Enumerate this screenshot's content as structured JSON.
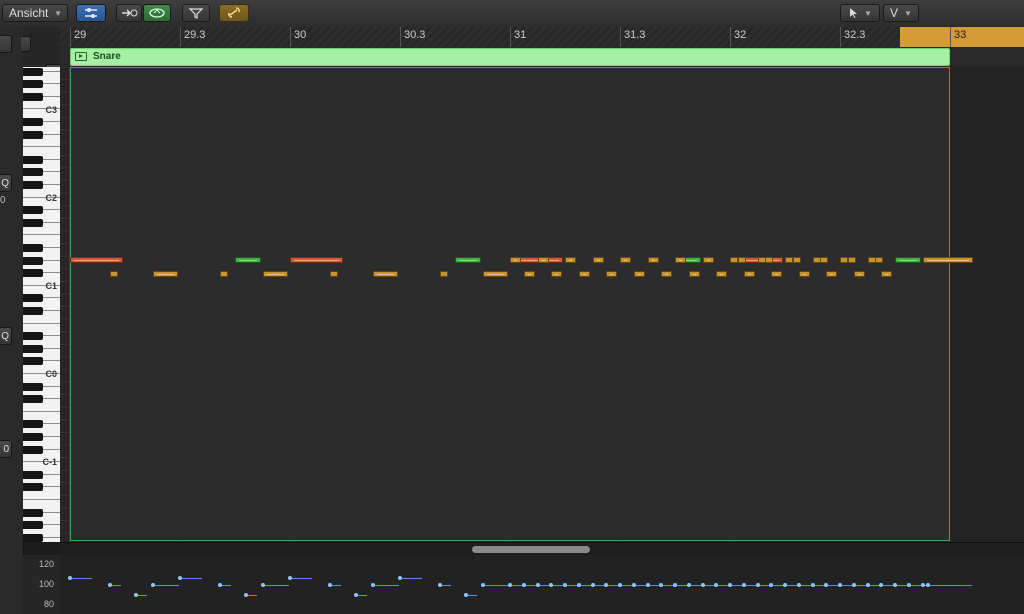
{
  "toolbar": {
    "view_menu_label": "Ansicht",
    "tool_pointer_label": "",
    "tool_secondary_label": "V",
    "colors": {
      "midi_in": "#2e63a8",
      "show_fx": "#3a8a45",
      "link": "#c79a3a"
    }
  },
  "ruler": {
    "bars": [
      "29",
      "29.3",
      "30",
      "30.3",
      "31",
      "31.3",
      "32",
      "32.3",
      "33"
    ],
    "cycle_color": "#d59b37"
  },
  "region": {
    "name": "Snare",
    "color": "#a6f0a6"
  },
  "piano": {
    "labels": [
      "C3",
      "C2",
      "C1",
      "C0",
      "C-1"
    ]
  },
  "left_panel": {
    "button_labels": [
      "",
      "Q",
      "0",
      "Q",
      "0"
    ]
  },
  "velocity": {
    "labels": [
      "120",
      "100",
      "80"
    ]
  },
  "notes": {
    "colors": {
      "loud": "#d05a32",
      "accent": "#3fb33f",
      "medium": "#c8922c"
    },
    "row_high": [
      {
        "start": 29.0,
        "len": 0.25,
        "vel": "loud"
      },
      {
        "start": 29.75,
        "len": 0.125,
        "vel": "accent"
      },
      {
        "start": 30.0,
        "len": 0.25,
        "vel": "loud"
      },
      {
        "start": 30.75,
        "len": 0.125,
        "vel": "accent"
      },
      {
        "start": 31.0,
        "len": 0.25,
        "vel": "loud"
      },
      {
        "start": 31.75,
        "len": 0.125,
        "vel": "accent"
      },
      {
        "start": 32.0,
        "len": 0.25,
        "vel": "loud"
      },
      {
        "start": 32.75,
        "len": 0.125,
        "vel": "accent"
      }
    ]
  }
}
